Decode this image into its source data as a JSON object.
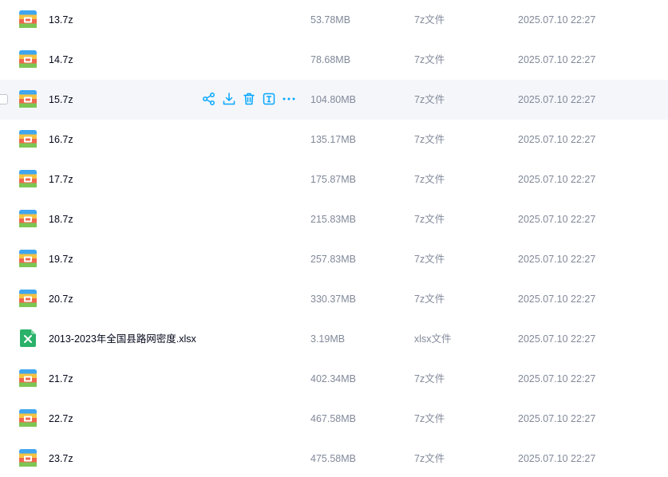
{
  "colors": {
    "accent": "#06a7ff",
    "name_text": "#03081a",
    "meta_text": "#818999",
    "hover_row": "#f5f6fa",
    "xlsx_green": "#2ab16a"
  },
  "files": [
    {
      "name": "13.7z",
      "size": "53.78MB",
      "type": "7z文件",
      "date": "2025.07.10 22:27",
      "icon": "archive-icon",
      "hover": false
    },
    {
      "name": "14.7z",
      "size": "78.68MB",
      "type": "7z文件",
      "date": "2025.07.10 22:27",
      "icon": "archive-icon",
      "hover": false
    },
    {
      "name": "15.7z",
      "size": "104.80MB",
      "type": "7z文件",
      "date": "2025.07.10 22:27",
      "icon": "archive-icon",
      "hover": true
    },
    {
      "name": "16.7z",
      "size": "135.17MB",
      "type": "7z文件",
      "date": "2025.07.10 22:27",
      "icon": "archive-icon",
      "hover": false
    },
    {
      "name": "17.7z",
      "size": "175.87MB",
      "type": "7z文件",
      "date": "2025.07.10 22:27",
      "icon": "archive-icon",
      "hover": false
    },
    {
      "name": "18.7z",
      "size": "215.83MB",
      "type": "7z文件",
      "date": "2025.07.10 22:27",
      "icon": "archive-icon",
      "hover": false
    },
    {
      "name": "19.7z",
      "size": "257.83MB",
      "type": "7z文件",
      "date": "2025.07.10 22:27",
      "icon": "archive-icon",
      "hover": false
    },
    {
      "name": "20.7z",
      "size": "330.37MB",
      "type": "7z文件",
      "date": "2025.07.10 22:27",
      "icon": "archive-icon",
      "hover": false
    },
    {
      "name": "2013-2023年全国县路网密度.xlsx",
      "size": "3.19MB",
      "type": "xlsx文件",
      "date": "2025.07.10 22:27",
      "icon": "excel-icon",
      "hover": false
    },
    {
      "name": "21.7z",
      "size": "402.34MB",
      "type": "7z文件",
      "date": "2025.07.10 22:27",
      "icon": "archive-icon",
      "hover": false
    },
    {
      "name": "22.7z",
      "size": "467.58MB",
      "type": "7z文件",
      "date": "2025.07.10 22:27",
      "icon": "archive-icon",
      "hover": false
    },
    {
      "name": "23.7z",
      "size": "475.58MB",
      "type": "7z文件",
      "date": "2025.07.10 22:27",
      "icon": "archive-icon",
      "hover": false
    }
  ],
  "row_actions": [
    "share-icon",
    "download-icon",
    "delete-icon",
    "rename-icon",
    "more-icon"
  ]
}
